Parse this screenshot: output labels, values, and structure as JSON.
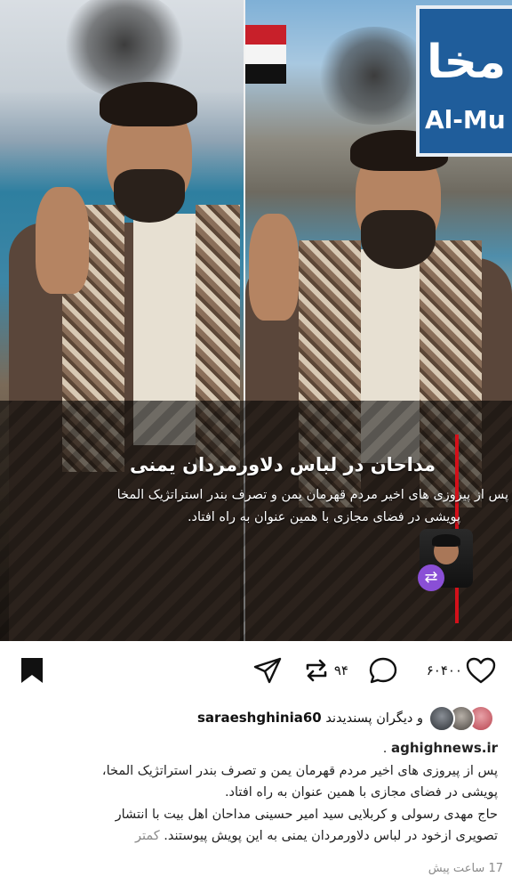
{
  "post": {
    "headline": "مداحان در لباس دلاورمردان یمنی",
    "subtitle_line1": "پس از پیروزی های اخیر مردم قهرمان یمن و تصرف بندر استراتژیک المخا",
    "subtitle_line2": "پویشی در فضای مجازی با همین عنوان به راه افتاد.",
    "sign_arabic": "مخا",
    "sign_latin": "Al-Mu"
  },
  "actions": {
    "likes_count": "۶۰۴۰۰",
    "reposts_count": "۹۴",
    "icons": [
      "heart-icon",
      "comment-icon",
      "repost-icon",
      "share-icon",
      "bookmark-icon"
    ]
  },
  "liked_by": {
    "prefix": "و دیگران پسندیدند",
    "username": "saraeshghinia60"
  },
  "caption": {
    "link": "aghighnews.ir",
    "dot": ".",
    "line1": "پس از پیروزی های اخیر مردم قهرمان یمن و تصرف بندر استراتژیک المخا،",
    "line2": "پویشی در فضای مجازی با همین عنوان به راه افتاد.",
    "line3": "حاج مهدی رسولی و کربلایی سید امیر حسینی مداحان اهل بیت با انتشار",
    "line4": "تصویری ازخود در لباس دلاورمردان یمنی به این پویش پیوستند.",
    "more": "کمتر"
  },
  "timestamp": "17 ساعت پیش",
  "colors": {
    "accent_red": "#d3101a",
    "badge_purple": "#8a4fd6"
  }
}
